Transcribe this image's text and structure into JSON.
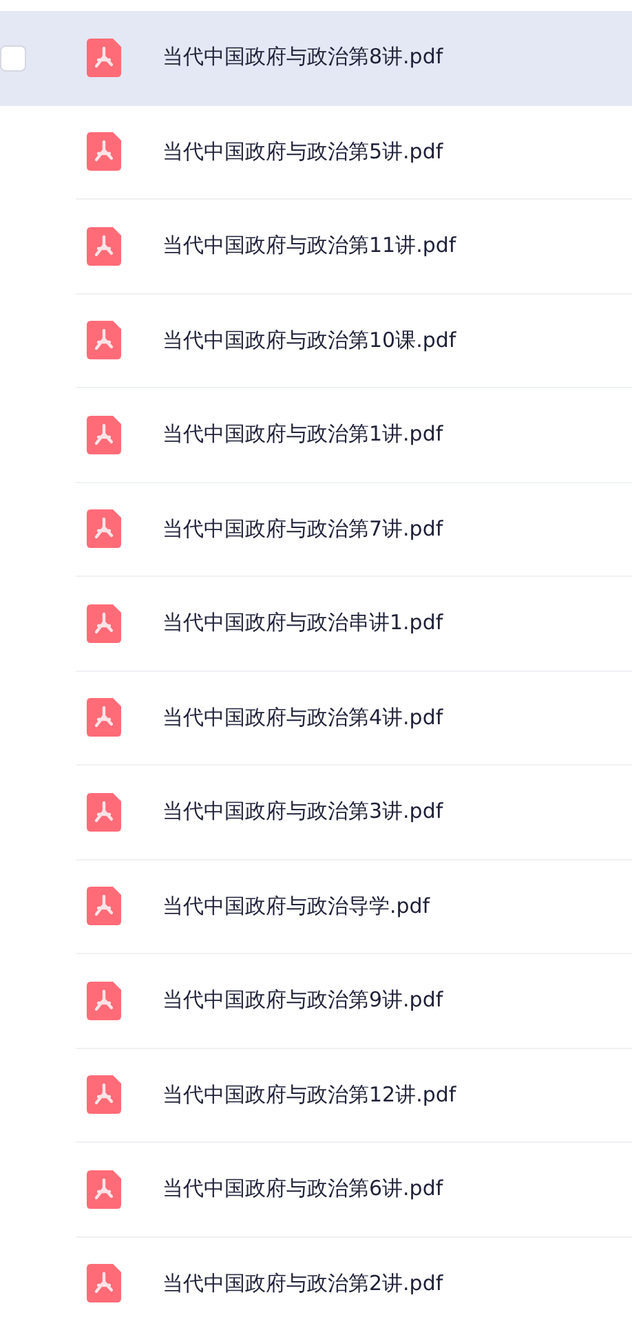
{
  "files": [
    {
      "name": "当代中国政府与政治第8讲.pdf",
      "selected": true,
      "checked": false
    },
    {
      "name": "当代中国政府与政治第5讲.pdf",
      "selected": false,
      "checked": false
    },
    {
      "name": "当代中国政府与政治第11讲.pdf",
      "selected": false,
      "checked": false
    },
    {
      "name": "当代中国政府与政治第10课.pdf",
      "selected": false,
      "checked": false
    },
    {
      "name": "当代中国政府与政治第1讲.pdf",
      "selected": false,
      "checked": false
    },
    {
      "name": "当代中国政府与政治第7讲.pdf",
      "selected": false,
      "checked": false
    },
    {
      "name": "当代中国政府与政治串讲1.pdf",
      "selected": false,
      "checked": false
    },
    {
      "name": "当代中国政府与政治第4讲.pdf",
      "selected": false,
      "checked": false
    },
    {
      "name": "当代中国政府与政治第3讲.pdf",
      "selected": false,
      "checked": false
    },
    {
      "name": "当代中国政府与政治导学.pdf",
      "selected": false,
      "checked": false
    },
    {
      "name": "当代中国政府与政治第9讲.pdf",
      "selected": false,
      "checked": false
    },
    {
      "name": "当代中国政府与政治第12讲.pdf",
      "selected": false,
      "checked": false
    },
    {
      "name": "当代中国政府与政治第6讲.pdf",
      "selected": false,
      "checked": false
    },
    {
      "name": "当代中国政府与政治第2讲.pdf",
      "selected": false,
      "checked": false
    }
  ]
}
